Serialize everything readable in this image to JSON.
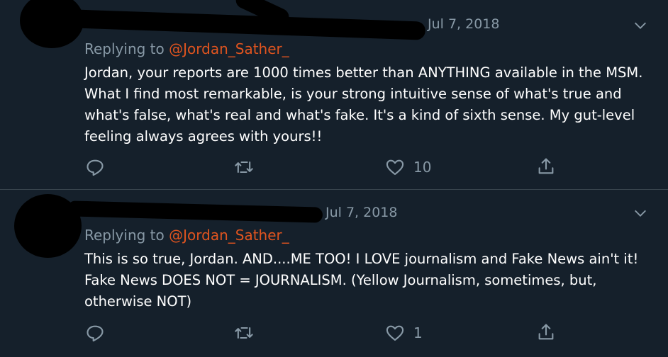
{
  "tweets": [
    {
      "date": "Jul 7, 2018",
      "replying_prefix": "Replying to",
      "replying_handle": "@Jordan_Sather_",
      "text": "Jordan, your reports are 1000 times better than ANYTHING available in the MSM. What I find most remarkable, is your strong intuitive sense of what's true and what's false, what's real and what's fake. It's a kind of sixth sense. My gut-level feeling always agrees with yours!!",
      "like_count": "10",
      "retweet_count": "",
      "reply_count": ""
    },
    {
      "date": "Jul 7, 2018",
      "replying_prefix": "Replying to",
      "replying_handle": "@Jordan_Sather_",
      "text": "This is so true, Jordan. AND....ME TOO! I LOVE journalism and Fake News ain't it! Fake News DOES NOT = JOURNALISM. (Yellow Journalism, sometimes, but, otherwise NOT)",
      "like_count": "1",
      "retweet_count": "",
      "reply_count": ""
    }
  ],
  "icons": {
    "reply": "reply-icon",
    "retweet": "retweet-icon",
    "like": "heart-icon",
    "share": "share-icon",
    "menu": "chevron-down-icon"
  },
  "colors": {
    "background": "#15202b",
    "secondary_text": "#8899a6",
    "handle": "#e0541f",
    "divider": "#38444d"
  }
}
